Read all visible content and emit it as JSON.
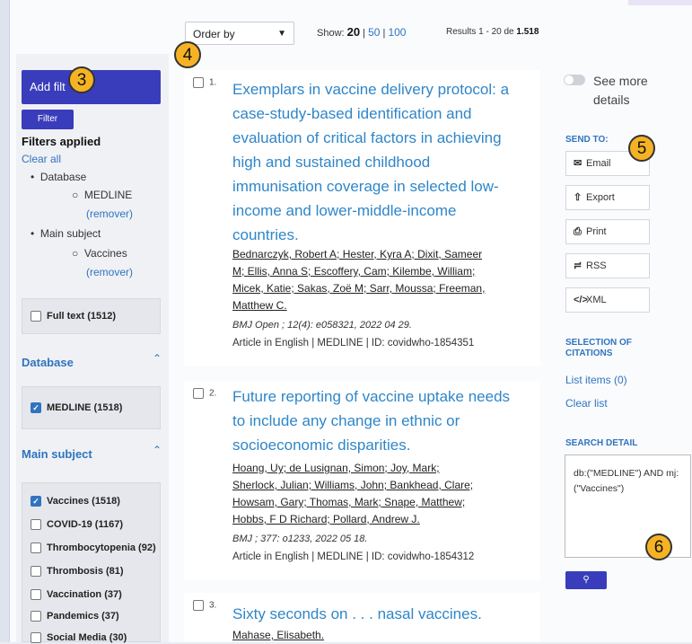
{
  "toolbar": {
    "order_by": "Order by",
    "show_label": "Show:",
    "show_current": "20",
    "show_opt1": "50",
    "show_sep": "|",
    "show_opt2": "100",
    "results_text": "Results 1 - 20 de",
    "results_total": "1.518"
  },
  "sidebar": {
    "add_filter": "Add filt",
    "filter_btn": "Filter",
    "filters_applied": "Filters applied",
    "clear_all": "Clear all",
    "tree": {
      "database": "Database",
      "medline": "MEDLINE",
      "remover1": "(remover)",
      "main_subject": "Main subject",
      "vaccines": "Vaccines",
      "remover2": "(remover)"
    },
    "full_text": "Full text (1512)",
    "database_head": "Database",
    "database_items": [
      {
        "label": "MEDLINE (1518)",
        "checked": true
      }
    ],
    "main_subject_head": "Main subject",
    "main_subject_items": [
      {
        "label": "Vaccines (1518)",
        "checked": true
      },
      {
        "label": "COVID-19 (1167)",
        "checked": false
      },
      {
        "label": "Thrombocytopenia (92)",
        "checked": false
      },
      {
        "label": "Thrombosis (81)",
        "checked": false
      },
      {
        "label": "Vaccination (37)",
        "checked": false
      },
      {
        "label": "Pandemics (37)",
        "checked": false
      },
      {
        "label": "Social Media (30)",
        "checked": false
      }
    ]
  },
  "results": [
    {
      "num": "1.",
      "title_lines": [
        "Exemplars in vaccine delivery protocol: a",
        "case-study-based identification and",
        "evaluation of critical factors in achieving",
        "high and sustained childhood",
        "immunisation coverage in selected low-",
        "income and lower-middle-income",
        "countries."
      ],
      "author_lines": [
        "Bednarczyk, Robert A; Hester, Kyra A; Dixit, Sameer",
        "M; Ellis, Anna S; Escoffery, Cam; Kilembe, William;",
        "Micek, Katie; Sakas, Zoë M; Sarr, Moussa; Freeman,",
        "Matthew C."
      ],
      "source": "BMJ Open ; 12(4): e058321, 2022 04 29.",
      "meta": "Article in English | MEDLINE | ID: covidwho-1854351"
    },
    {
      "num": "2.",
      "title_lines": [
        "Future reporting of vaccine uptake needs",
        "to include any change in ethnic or",
        "socioeconomic disparities."
      ],
      "author_lines": [
        "Hoang, Uy; de Lusignan, Simon; Joy, Mark;",
        "Sherlock, Julian; Williams, John; Bankhead, Clare;",
        "Howsam, Gary; Thomas, Mark; Snape, Matthew;",
        "Hobbs, F D Richard; Pollard, Andrew J."
      ],
      "source": "BMJ ; 377: o1233, 2022 05 18.",
      "meta": "Article in English | MEDLINE | ID: covidwho-1854312"
    },
    {
      "num": "3.",
      "title_lines": [
        "Sixty seconds on . . . nasal vaccines."
      ],
      "author_lines": [
        "Mahase, Elisabeth."
      ],
      "source": "",
      "meta": ""
    }
  ],
  "right": {
    "see_more": "See more details",
    "send_to": "SEND TO:",
    "email": "Email",
    "export": "Export",
    "print": "Print",
    "rss": "RSS",
    "xml": "XML",
    "selection_head_1": "SELECTION OF",
    "selection_head_2": "CITATIONS",
    "list_items": "List items (0)",
    "clear_list": "Clear list",
    "search_detail_head": "SEARCH DETAIL",
    "search_detail": "db:(\"MEDLINE\") AND mj: (\"Vaccines\")"
  },
  "callouts": {
    "c3": "3",
    "c4": "4",
    "c5": "5",
    "c6": "6"
  },
  "colors": {
    "primary": "#3a3dbb",
    "link": "#2f74c0",
    "title": "#2f86c8",
    "callout": "#f5b324"
  }
}
